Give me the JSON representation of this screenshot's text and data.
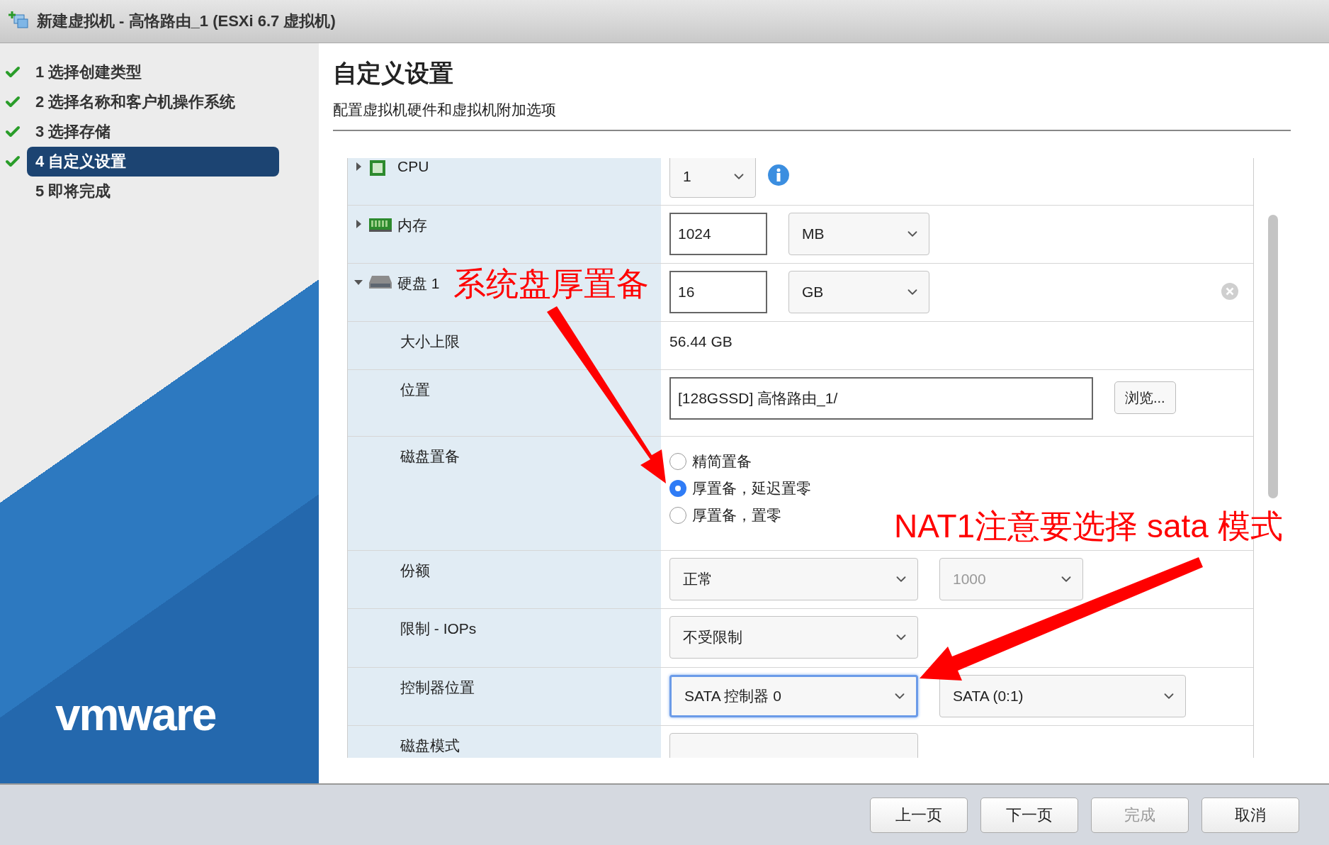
{
  "window": {
    "title": "新建虚拟机 - 高恪路由_1 (ESXi 6.7 虚拟机)"
  },
  "steps": [
    {
      "label": "1 选择创建类型",
      "done": true,
      "selected": false
    },
    {
      "label": "2 选择名称和客户机操作系统",
      "done": true,
      "selected": false
    },
    {
      "label": "3 选择存储",
      "done": true,
      "selected": false
    },
    {
      "label": "4 自定义设置",
      "done": true,
      "selected": true
    },
    {
      "label": "5 即将完成",
      "done": false,
      "selected": false
    }
  ],
  "logo": "vmware",
  "page": {
    "heading": "自定义设置",
    "subtitle": "配置虚拟机硬件和虚拟机附加选项"
  },
  "rows": [
    {
      "label": "CPU",
      "expanded": false,
      "controls": [
        {
          "kind": "select",
          "value": "1"
        },
        {
          "kind": "info"
        }
      ]
    },
    {
      "label": "内存",
      "expanded": false,
      "controls": [
        {
          "kind": "input",
          "value": "1024"
        },
        {
          "kind": "select",
          "value": "MB"
        }
      ]
    },
    {
      "label": "硬盘 1",
      "expanded": true,
      "controls": [
        {
          "kind": "input",
          "value": "16"
        },
        {
          "kind": "select",
          "value": "GB"
        },
        {
          "kind": "remove"
        }
      ]
    },
    {
      "label": "大小上限",
      "controls": [
        {
          "kind": "text",
          "value": "56.44 GB"
        }
      ]
    },
    {
      "label": "位置",
      "controls": [
        {
          "kind": "input",
          "value": "[128GSSD] 高恪路由_1/"
        },
        {
          "kind": "button",
          "value": "浏览..."
        }
      ]
    },
    {
      "label": "磁盘置备",
      "controls": [
        {
          "kind": "radio",
          "options": [
            {
              "label": "精简置备",
              "selected": false
            },
            {
              "label": "厚置备，延迟置零",
              "selected": true
            },
            {
              "label": "厚置备，置零",
              "selected": false
            }
          ]
        }
      ]
    },
    {
      "label": "份额",
      "controls": [
        {
          "kind": "select",
          "value": "正常"
        },
        {
          "kind": "select",
          "value": "1000",
          "disabled": true
        }
      ]
    },
    {
      "label": "限制 - IOPs",
      "controls": [
        {
          "kind": "select",
          "value": "不受限制"
        }
      ]
    },
    {
      "label": "控制器位置",
      "controls": [
        {
          "kind": "select",
          "value": "SATA 控制器 0",
          "focused": true
        },
        {
          "kind": "select",
          "value": "SATA (0:1)"
        }
      ]
    },
    {
      "label": "磁盘模式",
      "controls": [
        {
          "kind": "select"
        }
      ]
    }
  ],
  "annotations": [
    {
      "text": "系统盘厚置备"
    },
    {
      "text": "NAT1注意要选择 sata 模式"
    }
  ],
  "buttons": [
    {
      "label": "上一页",
      "disabled": false
    },
    {
      "label": "下一页",
      "disabled": false
    },
    {
      "label": "完成",
      "disabled": true
    },
    {
      "label": "取消",
      "disabled": false
    }
  ]
}
